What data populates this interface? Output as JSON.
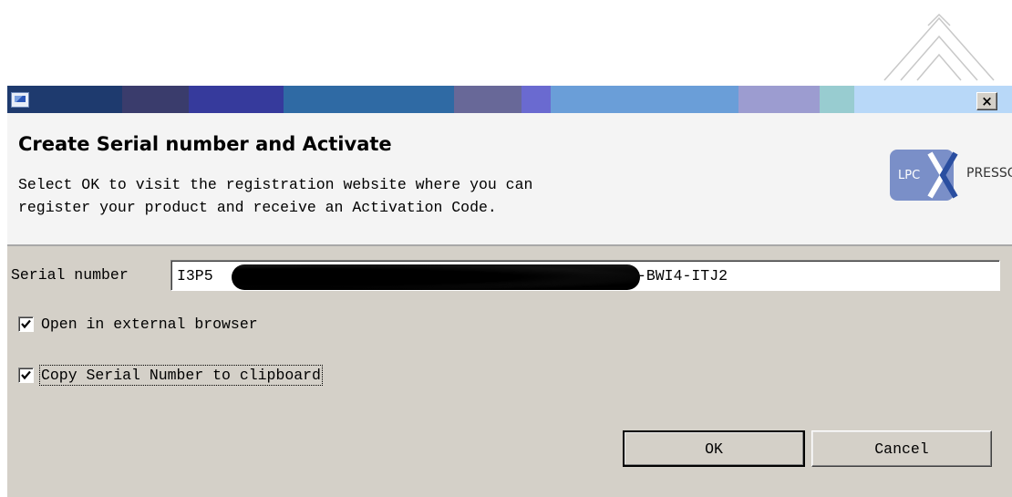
{
  "window": {
    "close_label": "×",
    "titlebar_colors": [
      "#1e3a6e",
      "#3a3c6c",
      "#363a9c",
      "#2f6aa4",
      "#686898",
      "#6a6ad0",
      "#6a9ed8",
      "#9c9cd0",
      "#98ccd0",
      "#b8d8f8"
    ]
  },
  "banner": {
    "title": "Create Serial number and Activate",
    "description_line1": "Select OK to visit the registration website where you can",
    "description_line2": "register your product and receive an Activation Code.",
    "logo_left": "LPC",
    "logo_right": "PRESSO"
  },
  "form": {
    "serial_label": "Serial number",
    "serial_value": "I3P5                                           B4E3-BWI4-ITJ2",
    "open_external_label": "Open in external browser",
    "open_external_checked": true,
    "copy_serial_label": "Copy Serial Number to clipboard",
    "copy_serial_checked": true
  },
  "buttons": {
    "ok_label": "OK",
    "cancel_label": "Cancel"
  },
  "icons": {
    "app": "lpcxpresso-app-icon",
    "close": "close-icon",
    "check": "checkmark-icon"
  }
}
